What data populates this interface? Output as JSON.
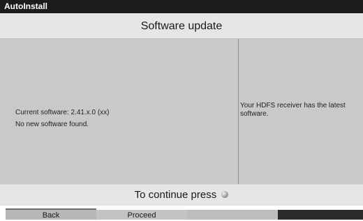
{
  "window": {
    "title": "AutoInstall"
  },
  "header": {
    "title": "Software update"
  },
  "main": {
    "current_software": "Current software: 2.41.x.0 (xx)",
    "status": "No new software found.",
    "message": "Your HDFS receiver has the latest software."
  },
  "footer": {
    "continue_text": "To continue press",
    "continue_icon": "ok-button-icon"
  },
  "buttons": {
    "back": "Back",
    "proceed": "Proceed",
    "button3": "",
    "button4": ""
  },
  "colors": {
    "titlebar": "#1c1c1c",
    "content": "#c9c9c9",
    "header": "#e6e6e6"
  }
}
